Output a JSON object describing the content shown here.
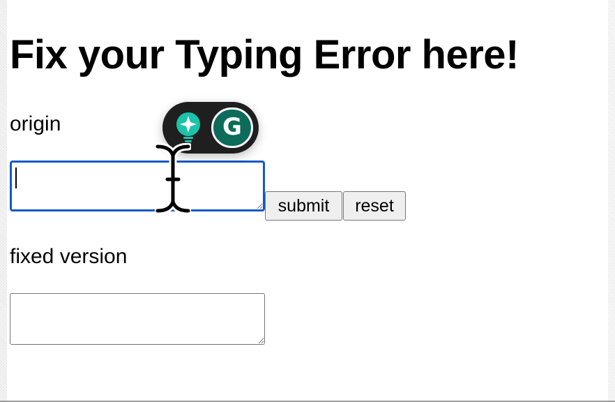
{
  "page": {
    "title": "Fix your Typing Error here!"
  },
  "origin": {
    "label": "origin",
    "value": ""
  },
  "fixed": {
    "label": "fixed version",
    "value": ""
  },
  "buttons": {
    "submit_label": "submit",
    "reset_label": "reset"
  },
  "grammarly": {
    "bulb_icon": "lightbulb-sparkle-icon",
    "logo_icon": "grammarly-g-icon",
    "logo_text": "G"
  },
  "colors": {
    "focus_border": "#1358c9",
    "grammarly_bg": "#1f1f1f",
    "grammarly_green": "#0d6b5a",
    "bulb_teal": "#19c4a8"
  }
}
